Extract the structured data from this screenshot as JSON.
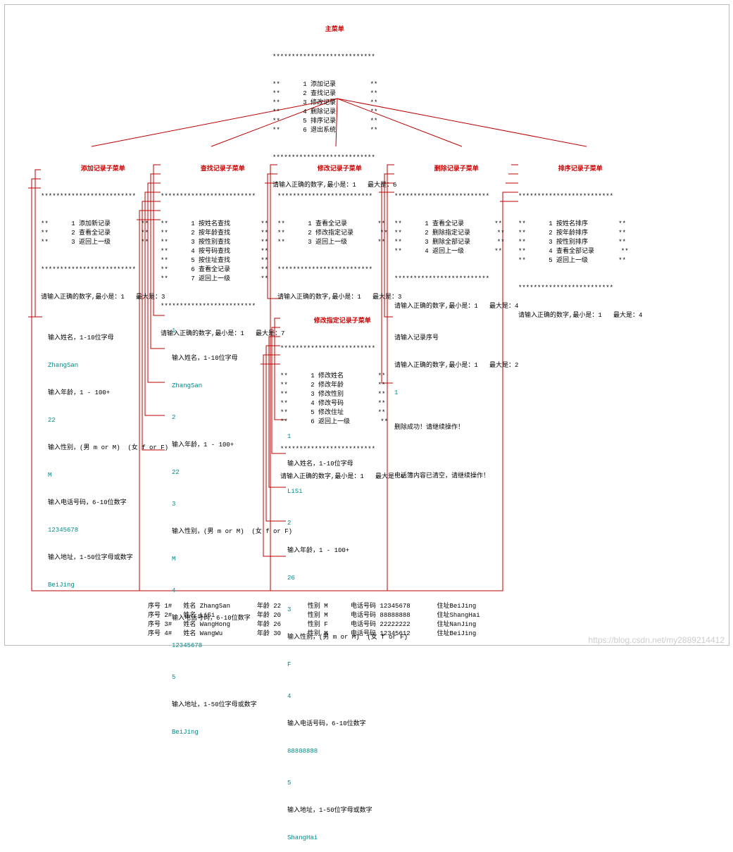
{
  "main_menu": {
    "title": "主菜单",
    "items": [
      "1 添加记录",
      "2 查找记录",
      "3 修改记录",
      "4 删除记录",
      "5 排序记录",
      "6 退出系统"
    ],
    "prompt": "请输入正确的数字,最小是：1   最大是：6"
  },
  "submenus": {
    "add": {
      "title": "添加记录子菜单",
      "items": [
        "1 添加新记录",
        "2 查看全记录",
        "3 返回上一级"
      ],
      "prompt": "请输入正确的数字,最小是：1   最大是：3"
    },
    "find": {
      "title": "查找记录子菜单",
      "items": [
        "1 按姓名查找",
        "2 按年龄查找",
        "3 按性别查找",
        "4 按号码查找",
        "5 按住址查找",
        "6 查看全记录",
        "7 返回上一级"
      ],
      "prompt": "请输入正确的数字,最小是：1   最大是：7"
    },
    "modify": {
      "title": "修改记录子菜单",
      "items": [
        "1 查看全记录",
        "2 修改指定记录",
        "3 返回上一级"
      ],
      "prompt": "请输入正确的数字,最小是：1   最大是：3"
    },
    "delete": {
      "title": "删除记录子菜单",
      "items": [
        "1 查看全记录",
        "2 删除指定记录",
        "3 删除全部记录",
        "4 返回上一级"
      ],
      "prompt": "请输入正确的数字,最小是：1   最大是：4"
    },
    "sort": {
      "title": "排序记录子菜单",
      "items": [
        "1 按姓名排序",
        "2 按年龄排序",
        "3 按性别排序",
        "4 查看全部记录",
        "5 返回上一级"
      ],
      "prompt": "请输入正确的数字,最小是：1   最大是：4"
    }
  },
  "modify_detail": {
    "title": "修改指定记录子菜单",
    "items": [
      "1 修改姓名",
      "2 修改年龄",
      "3 修改性别",
      "4 修改号码",
      "5 修改住址",
      "6 返回上一级"
    ],
    "prompt": "请输入正确的数字,最小是：1   最大是：6"
  },
  "add_inputs": {
    "l1": "输入姓名，1-10位字母",
    "v1": "ZhangSan",
    "l2": "输入年龄，1 - 100+",
    "v2": "22",
    "l3": "输入性别，(男 m or M)  (女 f or F)",
    "v3": "M",
    "l4": "输入电话号码，6-10位数字",
    "v4": "12345678",
    "l5": "输入地址，1-50位字母或数字",
    "v5": "BeiJing"
  },
  "find_inputs": {
    "n1": "1",
    "l1": "输入姓名，1-10位字母",
    "v1": "ZhangSan",
    "n2": "2",
    "l2": "输入年龄，1 - 100+",
    "v2": "22",
    "n3": "3",
    "l3": "输入性别，(男 m or M)  (女 f or F)",
    "v3": "M",
    "n4": "4",
    "l4": "输入电话号码，6-10位数字",
    "v4": "12345678",
    "n5": "5",
    "l5": "输入地址，1-50位字母或数字",
    "v5": "BeiJing"
  },
  "modify_inputs": {
    "n1": "1",
    "l1": "输入姓名，1-10位字母",
    "v1": "LiSi",
    "n2": "2",
    "l2": "输入年龄，1 - 100+",
    "v2": "26",
    "n3": "3",
    "l3": "输入性别，(男 m or M)  (女 f or F)",
    "v3": "F",
    "n4": "4",
    "l4": "输入电话号码，6-10位数字",
    "v4": "88888888",
    "n5": "5",
    "l5": "输入地址，1-50位字母或数字",
    "v5": "ShangHai"
  },
  "delete_msgs": {
    "l1": "请输入记录序号",
    "l2": "请输入正确的数字,最小是：1   最大是：2",
    "l3": "1",
    "l4": "删除成功！请继续操作！",
    "l5": "电话簿内容已清空，请继续操作！"
  },
  "records": [
    {
      "idx": "序号 1#",
      "name": "姓名 ZhangSan",
      "age": "年龄 22",
      "sex": "性别 M",
      "tel": "电话号码 12345678",
      "addr": "住址BeiJing"
    },
    {
      "idx": "序号 2#",
      "name": "姓名 LiSi",
      "age": "年龄 20",
      "sex": "性别 M",
      "tel": "电话号码 88888888",
      "addr": "住址ShangHai"
    },
    {
      "idx": "序号 3#",
      "name": "姓名 WangHong",
      "age": "年龄 26",
      "sex": "性别 F",
      "tel": "电话号码 22222222",
      "addr": "住址NanJing"
    },
    {
      "idx": "序号 4#",
      "name": "姓名 WangWu",
      "age": "年龄 30",
      "sex": "性别 M",
      "tel": "电话号码 12345612",
      "addr": "住址BeiJing"
    }
  ],
  "watermark": "https://blog.csdn.net/my2889214412"
}
